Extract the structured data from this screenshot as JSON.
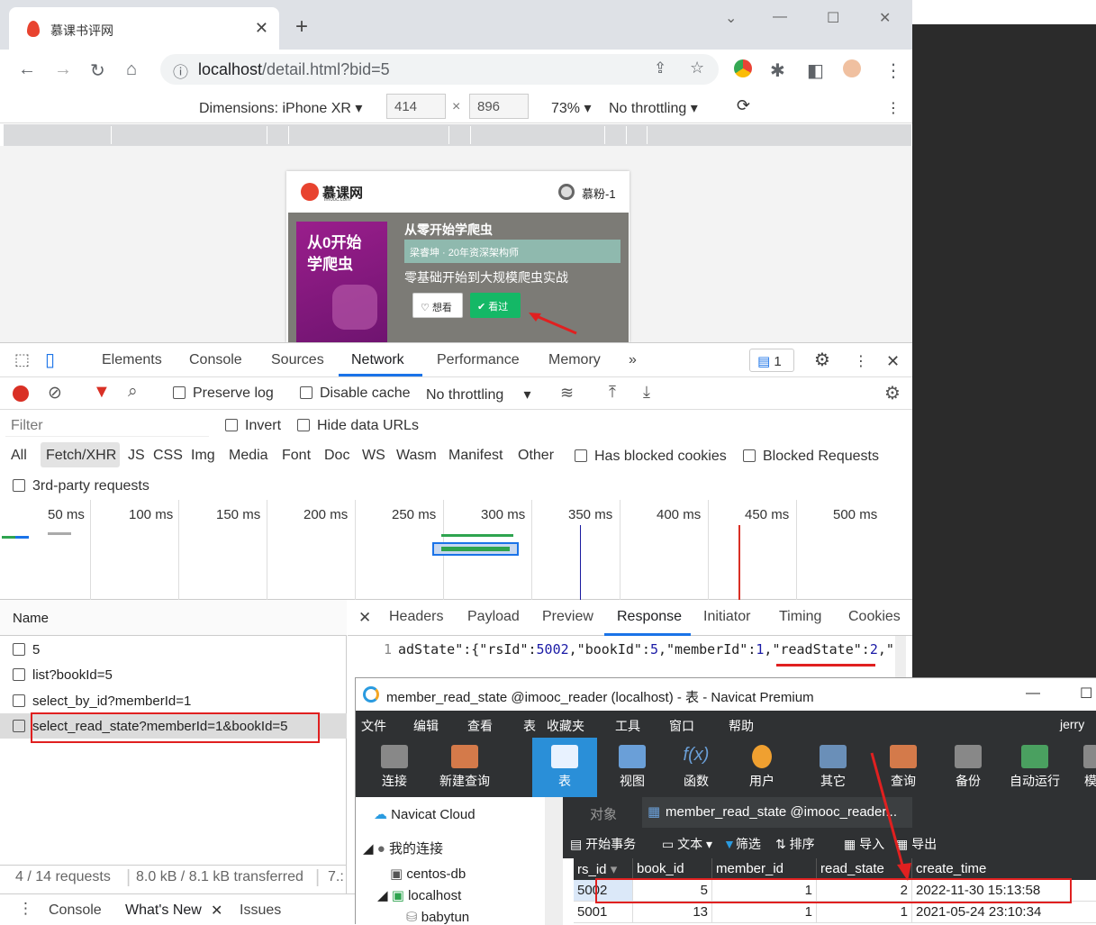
{
  "browser": {
    "tab_title": "慕课书评网",
    "url_host": "localhost",
    "url_path": "/detail.html?bid=5"
  },
  "device_toolbar": {
    "dimensions_label": "Dimensions: iPhone XR",
    "width": "414",
    "height": "896",
    "zoom": "73%",
    "throttle": "No throttling"
  },
  "page": {
    "logo_text": "慕课网",
    "logo_sub": "imooc.com",
    "user_name": "慕粉-1",
    "cover_line1": "从0开始",
    "cover_line2": "学爬虫",
    "book_title": "从零开始学爬虫",
    "author": "梁睿坤 · 20年资深架构师",
    "subtitle": "零基础开始到大规模爬虫实战",
    "want_label": "想看",
    "read_label": "看过"
  },
  "devtools": {
    "tabs": [
      "Elements",
      "Console",
      "Sources",
      "Network",
      "Performance",
      "Memory"
    ],
    "active_tab": "Network",
    "issues_count": "1",
    "preserve_log": "Preserve log",
    "disable_cache": "Disable cache",
    "throttle": "No throttling",
    "filter_placeholder": "Filter",
    "invert": "Invert",
    "hide_data_urls": "Hide data URLs",
    "types": [
      "All",
      "Fetch/XHR",
      "JS",
      "CSS",
      "Img",
      "Media",
      "Font",
      "Doc",
      "WS",
      "Wasm",
      "Manifest",
      "Other"
    ],
    "has_blocked_cookies": "Has blocked cookies",
    "blocked_requests": "Blocked Requests",
    "third_party": "3rd-party requests",
    "timeline_labels": [
      "50 ms",
      "100 ms",
      "150 ms",
      "200 ms",
      "250 ms",
      "300 ms",
      "350 ms",
      "400 ms",
      "450 ms",
      "500 ms"
    ],
    "name_header": "Name",
    "requests": [
      "5",
      "list?bookId=5",
      "select_by_id?memberId=1",
      "select_read_state?memberId=1&bookId=5"
    ],
    "detail_tabs": [
      "Headers",
      "Payload",
      "Preview",
      "Response",
      "Initiator",
      "Timing",
      "Cookies"
    ],
    "response_line_no": "1",
    "response_text_a": "adState\":{\"rsId\":",
    "response_num_1": "5002",
    "response_text_b": ",\"bookId\":",
    "response_num_2": "5",
    "response_text_c": ",\"memberId\":",
    "response_num_3": "1",
    "response_text_d": ",",
    "response_key": "\"readState\"",
    "response_colon": ":",
    "response_num_4": "2",
    "response_text_e": ",\"c",
    "status_requests": "4 / 14 requests",
    "status_transferred": "8.0 kB / 8.1 kB transferred",
    "status_more": "7.:",
    "drawer_tabs": [
      "Console",
      "What's New",
      "Issues"
    ]
  },
  "navicat": {
    "title": "member_read_state @imooc_reader (localhost) - 表 - Navicat Premium",
    "menu": [
      "文件",
      "编辑",
      "查看",
      "表",
      "收藏夹",
      "工具",
      "窗口",
      "帮助"
    ],
    "user": "jerry",
    "tools": [
      "连接",
      "新建查询",
      "表",
      "视图",
      "函数",
      "用户",
      "其它",
      "查询",
      "备份",
      "自动运行",
      "模"
    ],
    "tree_cloud": "Navicat Cloud",
    "tree_my": "我的连接",
    "tree_items": [
      "centos-db",
      "localhost",
      "babytun"
    ],
    "obj_tab": "对象",
    "table_tab": "member_read_state @imooc_reader...",
    "actions": [
      "开始事务",
      "文本",
      "筛选",
      "排序",
      "导入",
      "导出"
    ],
    "columns": [
      "rs_id",
      "book_id",
      "member_id",
      "read_state",
      "create_time"
    ],
    "rows": [
      [
        "5002",
        "5",
        "1",
        "2",
        "2022-11-30 15:13:58"
      ],
      [
        "5001",
        "13",
        "1",
        "1",
        "2021-05-24 23:10:34"
      ]
    ]
  },
  "colors": {
    "active_tab_blue": "#1a73e8",
    "annotation_red": "#e02020",
    "navicat_dark": "#2f3133",
    "green_button": "#14b866"
  }
}
